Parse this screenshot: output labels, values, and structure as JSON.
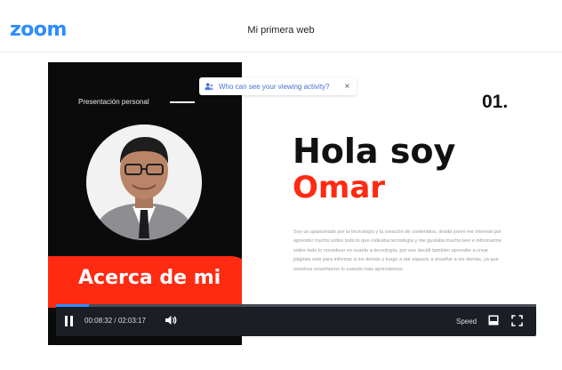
{
  "header": {
    "logo": "zoom",
    "meeting_title": "Mi primera web"
  },
  "notice": {
    "text": "Who can see your viewing activity?",
    "close": "×",
    "icon": "people-icon"
  },
  "slide": {
    "panel_caption": "Presentación personal",
    "number": "01.",
    "heading_line1": "Hola soy",
    "heading_line2": "Omar",
    "about_label": "Acerca de mi",
    "bio": "Soy un apasionado por la tecnología y la creación de contenidos, desde joven me interesé por aprender mucho sobre todo lo que rodeaba tecnología y me gustaba mucho leer e informarme sobre todo lo novedoso en cuanto a tecnología, por eso decidí también aprender a crear páginas web para informar a los demás y luego a dar espacio a enseñar a los demás, ya que nosotros enseñamos lo cuando más aprendemos.",
    "colors": {
      "accent_red": "#ff2a12",
      "panel_black": "#0b0b0b"
    }
  },
  "player": {
    "time_current": "00:08:32",
    "time_separator": " / ",
    "time_total": "02:03:17",
    "speed_label": "Speed",
    "progress": 0.069,
    "colors": {
      "bar": "#1c1e26",
      "progress": "#2d8cff"
    },
    "icons": [
      "pause-icon",
      "volume-icon",
      "mini-player-icon",
      "fullscreen-icon"
    ]
  }
}
